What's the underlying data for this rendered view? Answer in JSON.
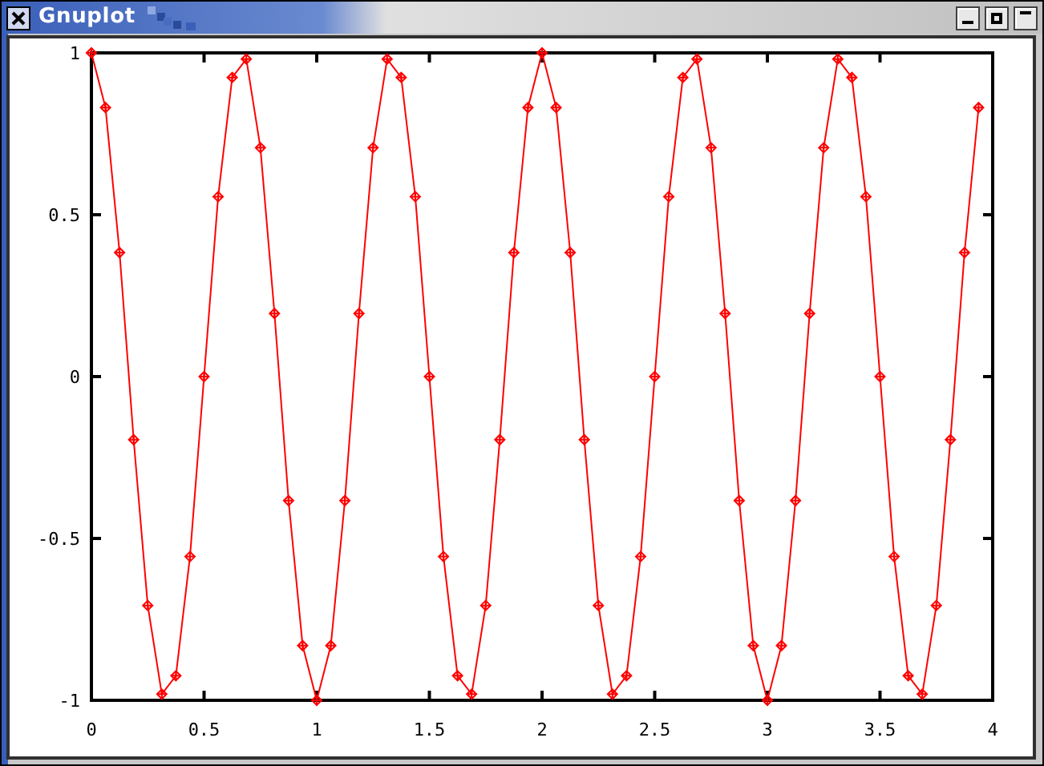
{
  "window": {
    "title": "Gnuplot"
  },
  "plot": {
    "chart_data": {
      "type": "line",
      "x": [
        0,
        0.0625,
        0.125,
        0.1875,
        0.25,
        0.3125,
        0.375,
        0.4375,
        0.5,
        0.5625,
        0.625,
        0.6875,
        0.75,
        0.8125,
        0.875,
        0.9375,
        1,
        1.0625,
        1.125,
        1.1875,
        1.25,
        1.3125,
        1.375,
        1.4375,
        1.5,
        1.5625,
        1.625,
        1.6875,
        1.75,
        1.8125,
        1.875,
        1.9375,
        2,
        2.0625,
        2.125,
        2.1875,
        2.25,
        2.3125,
        2.375,
        2.4375,
        2.5,
        2.5625,
        2.625,
        2.6875,
        2.75,
        2.8125,
        2.875,
        2.9375,
        3,
        3.0625,
        3.125,
        3.1875,
        3.25,
        3.3125,
        3.375,
        3.4375,
        3.5,
        3.5625,
        3.625,
        3.6875,
        3.75,
        3.8125,
        3.875,
        3.9375
      ],
      "series": [
        {
          "color": "#ff0000",
          "values": [
            1,
            0.831,
            0.383,
            -0.195,
            -0.707,
            -0.981,
            -0.924,
            -0.556,
            0,
            0.556,
            0.924,
            0.981,
            0.707,
            0.195,
            -0.383,
            -0.831,
            -1,
            -0.831,
            -0.383,
            0.195,
            0.707,
            0.981,
            0.924,
            0.556,
            0,
            -0.556,
            -0.924,
            -0.981,
            -0.707,
            -0.195,
            0.383,
            0.831,
            1,
            0.831,
            0.383,
            -0.195,
            -0.707,
            -0.981,
            -0.924,
            -0.556,
            0,
            0.556,
            0.924,
            0.981,
            0.707,
            0.195,
            -0.383,
            -0.831,
            -1,
            -0.831,
            -0.383,
            0.195,
            0.707,
            0.981,
            0.924,
            0.556,
            0,
            -0.556,
            -0.924,
            -0.981,
            -0.707,
            -0.195,
            0.383,
            0.831
          ]
        }
      ],
      "xlim": [
        0,
        4
      ],
      "ylim": [
        -1,
        1
      ],
      "xticks": [
        0,
        0.5,
        1,
        1.5,
        2,
        2.5,
        3,
        3.5,
        4
      ],
      "yticks": [
        -1,
        -0.5,
        0,
        0.5,
        1
      ]
    }
  }
}
